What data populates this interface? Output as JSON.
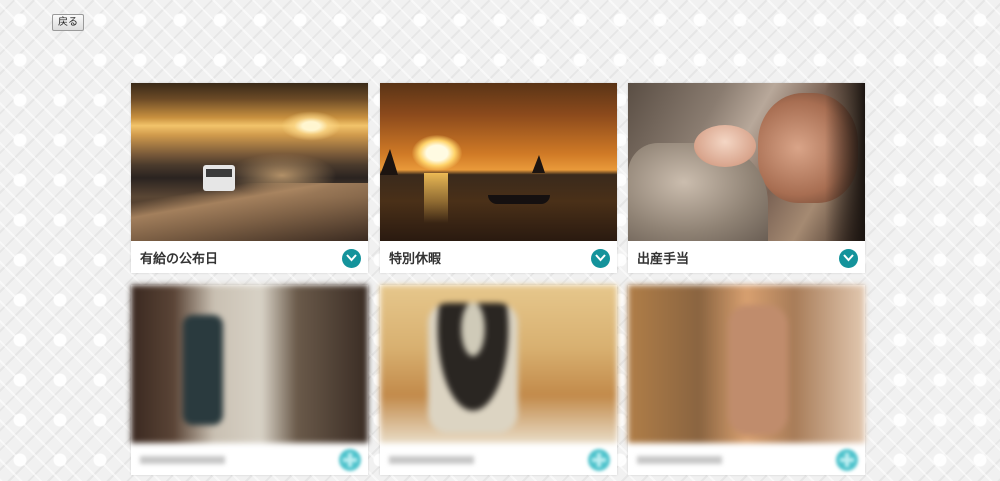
{
  "toolbar": {
    "back_label": "戻る"
  },
  "cards": [
    {
      "label": "有給の公布日",
      "photo": "car-on-road-at-sunset",
      "action_icon": "chevron-down-icon"
    },
    {
      "label": "特別休暇",
      "photo": "sailboats-at-sea-sunset",
      "action_icon": "chevron-down-icon"
    },
    {
      "label": "出産手当",
      "photo": "father-with-newborn-baby",
      "action_icon": "chevron-down-icon"
    },
    {
      "label": "",
      "photo": "blurred-photo",
      "action_icon": "plus-icon"
    },
    {
      "label": "",
      "photo": "blurred-photo",
      "action_icon": "plus-icon"
    },
    {
      "label": "",
      "photo": "blurred-photo",
      "action_icon": "plus-icon"
    }
  ],
  "colors": {
    "accent": "#14939b",
    "accent_light": "#4fc3cc"
  }
}
